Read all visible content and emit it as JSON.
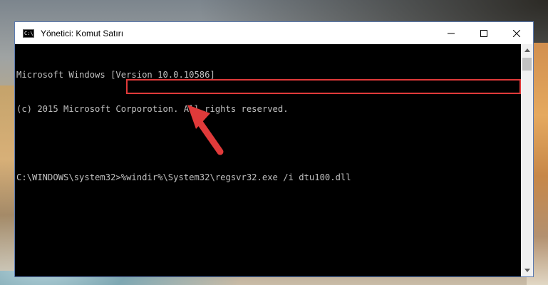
{
  "window": {
    "title": "Yönetici: Komut Satırı",
    "icon": "cmd-icon",
    "controls": [
      "minimize-icon",
      "maximize-icon",
      "close-icon"
    ]
  },
  "console": {
    "lines": [
      "Microsoft Windows [Version 10.0.10586]",
      "(c) 2015 Microsoft Corporotion. All rights reserved.",
      "",
      "C:\\WINDOWS\\system32>%windir%\\System32\\regsvr32.exe /i dtu100.dll"
    ]
  },
  "annotation": {
    "highlight_color": "#e03a3a",
    "arrow_color": "#e03a3a"
  }
}
